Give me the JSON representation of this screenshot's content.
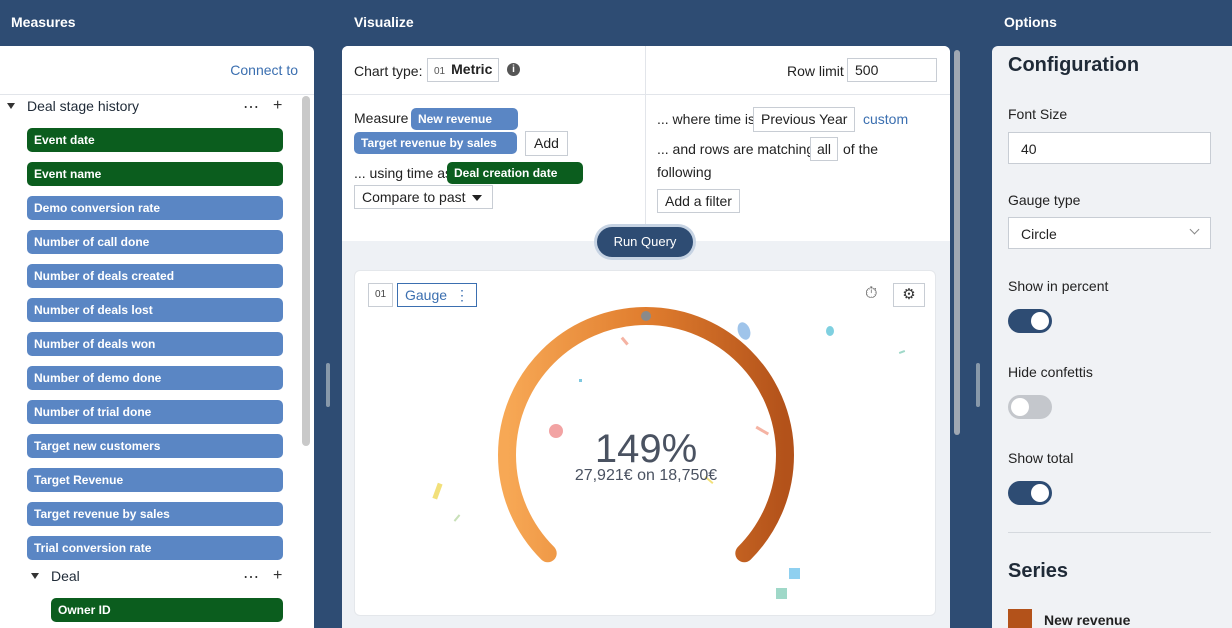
{
  "columns": {
    "measures": "Measures",
    "visualize": "Visualize",
    "options": "Options"
  },
  "measures": {
    "connect_link": "Connect to",
    "group": {
      "label": "Deal stage history",
      "more": "⋯",
      "add": "+"
    },
    "items": [
      {
        "label": "Event date",
        "color": "#0b5d1e"
      },
      {
        "label": "Event name",
        "color": "#0b5d1e"
      },
      {
        "label": "Demo conversion rate",
        "color": "#5a86c4"
      },
      {
        "label": "Number of call done",
        "color": "#5a86c4"
      },
      {
        "label": "Number of deals created",
        "color": "#5a86c4"
      },
      {
        "label": "Number of deals lost",
        "color": "#5a86c4"
      },
      {
        "label": "Number of deals won",
        "color": "#5a86c4"
      },
      {
        "label": "Number of demo done",
        "color": "#5a86c4"
      },
      {
        "label": "Number of trial done",
        "color": "#5a86c4"
      },
      {
        "label": "Target new customers",
        "color": "#5a86c4"
      },
      {
        "label": "Target Revenue",
        "color": "#5a86c4"
      },
      {
        "label": "Target revenue by sales",
        "color": "#5a86c4"
      },
      {
        "label": "Trial conversion rate",
        "color": "#5a86c4"
      }
    ],
    "subgroup": {
      "label": "Deal",
      "more": "⋯",
      "add": "+"
    },
    "subitems": [
      {
        "label": "Owner ID",
        "color": "#0b5d1e"
      }
    ]
  },
  "visualize": {
    "chart_type_label": "Chart type:",
    "chart_type_num": "01",
    "chart_type_value": "Metric",
    "info_icon": "i",
    "row_limit_label": "Row limit",
    "row_limit_value": "500",
    "measure_label": "Measure",
    "measure_chips": [
      "New revenue",
      "Target revenue by sales"
    ],
    "add_button": "Add",
    "using_time_label": "... using time as",
    "time_chip": "Deal creation date",
    "compare_select": "Compare to past",
    "where_time_label": "... where time is",
    "where_time_value": "Previous Year",
    "custom_link": "custom",
    "rows_matching_label": "... and rows are matching",
    "rows_matching_value": "all",
    "of_the": "of the",
    "following": "following",
    "add_filter": "Add a filter",
    "run_query": "Run Query",
    "card": {
      "num": "01",
      "name": "Gauge",
      "name_menu": "⋮",
      "timer_icon": "⏱",
      "settings_icon": "⚙",
      "percent": "149%",
      "total": "27,921€ on 18,750€",
      "gauge_value": 1.49
    }
  },
  "options": {
    "configuration_title": "Configuration",
    "font_size_label": "Font Size",
    "font_size_value": "40",
    "gauge_type_label": "Gauge type",
    "gauge_type_value": "Circle",
    "show_percent_label": "Show in percent",
    "show_percent": true,
    "hide_confettis_label": "Hide confettis",
    "hide_confettis": false,
    "show_total_label": "Show total",
    "show_total": true,
    "series_title": "Series",
    "series_name": "New revenue",
    "series_color": "#b3521a"
  }
}
